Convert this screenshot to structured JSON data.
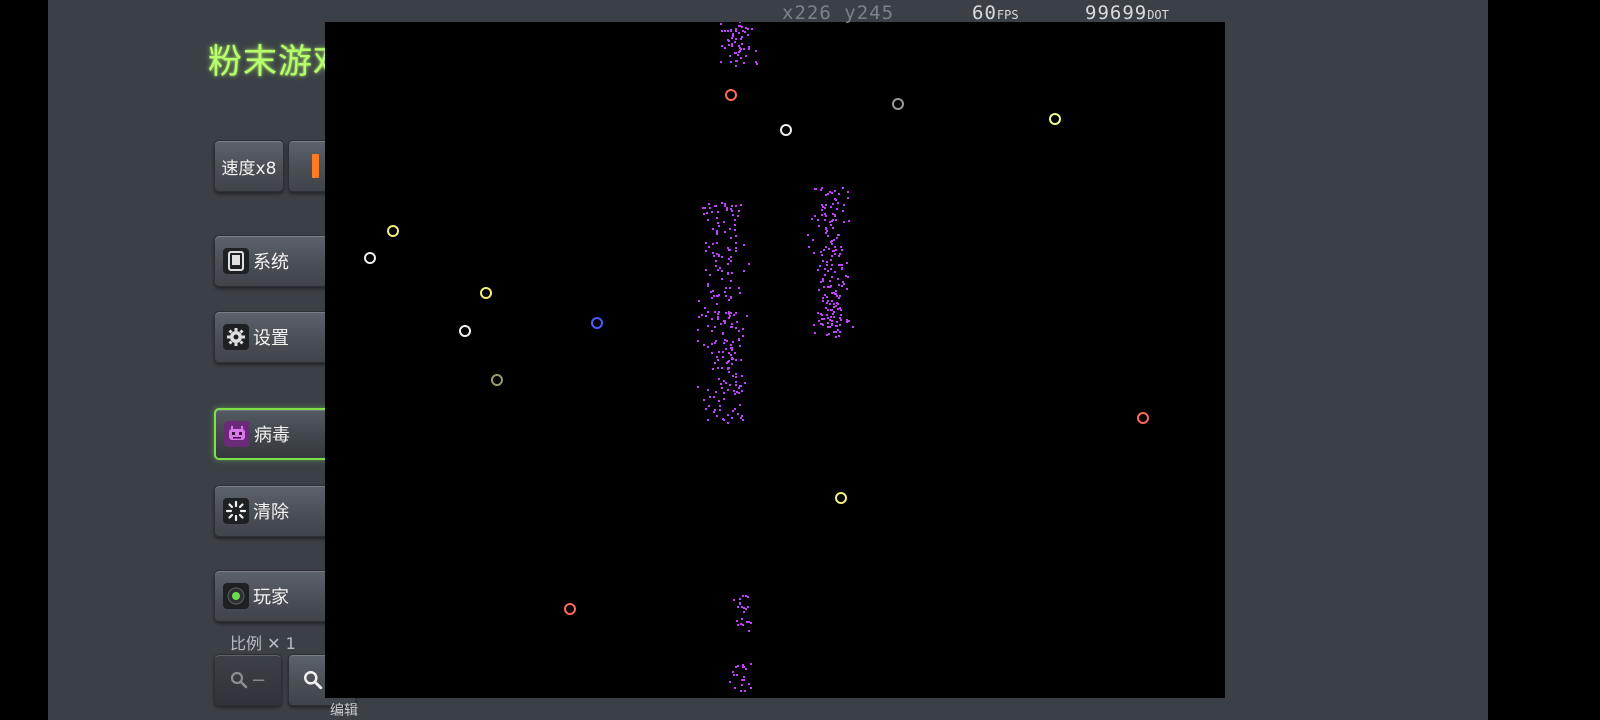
{
  "app": {
    "title": "粉末游戏"
  },
  "controls": {
    "speed_label": "速度x8",
    "system_label": "系统",
    "settings_label": "设置",
    "virus_label": "病毒",
    "clear_label": "清除",
    "player_label": "玩家",
    "scale_label": "比例 ✕ 1",
    "zoom_out_sign": "−",
    "zoom_in_sign": "+",
    "selected_tool": "病毒"
  },
  "hud": {
    "x_label": "x",
    "x_value": "226",
    "y_label": "y",
    "y_value": "245",
    "fps_value": "60",
    "fps_label": "FPS",
    "dot_value": "99699",
    "dot_label": "DOT"
  },
  "footer": {
    "edit_label": "编辑"
  },
  "colors": {
    "title_glow": "#b7ff6b",
    "pause_accent": "#ff7a22",
    "selected_border": "#7ee04a",
    "virus_particle": "#c040ff",
    "ring_yellow": "#f5f07a",
    "ring_white": "#f0f0f0",
    "ring_red": "#ff6a5a",
    "ring_blue": "#4b5bff",
    "ring_gray": "#9a9a9a"
  }
}
